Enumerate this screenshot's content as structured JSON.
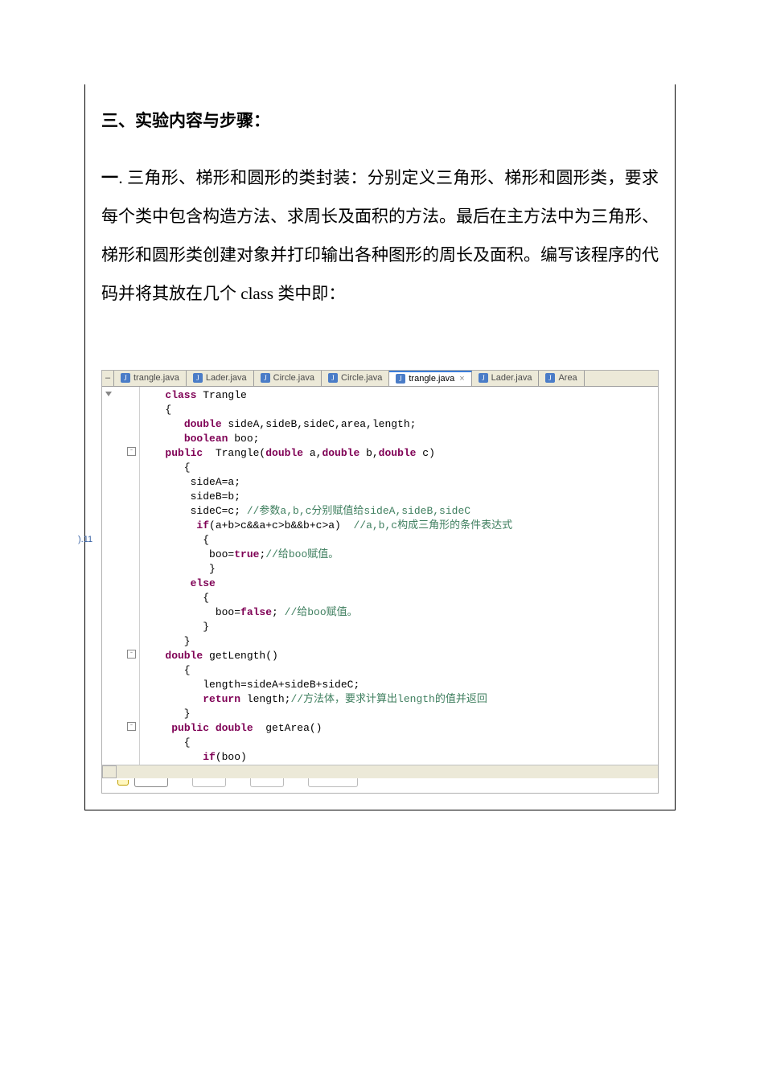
{
  "heading": "三、实验内容与步骤：",
  "body_prefix_bold": "一",
  "body_text": ". 三角形、梯形和圆形的类封装：分别定义三角形、梯形和圆形类，要求每个类中包含构造方法、求周长及面积的方法。最后在主方法中为三角形、梯形和圆形类创建对象并打印输出各种图形的周长及面积。编写该程序的代码并将其放在几个 class 类中即：",
  "tabs": [
    {
      "label": "trangle.java",
      "active": false
    },
    {
      "label": "Lader.java",
      "active": false
    },
    {
      "label": "Circle.java",
      "active": false
    },
    {
      "label": "Circle.java",
      "active": false
    },
    {
      "label": "trangle.java",
      "active": true
    },
    {
      "label": "Lader.java",
      "active": false
    },
    {
      "label": "Area",
      "active": false
    }
  ],
  "breakpoint_label": ").11",
  "code_lines": [
    {
      "indent": 1,
      "tokens": [
        [
          "kw",
          "class"
        ],
        [
          "",
          " Trangle"
        ]
      ]
    },
    {
      "indent": 1,
      "tokens": [
        [
          "",
          "{"
        ]
      ]
    },
    {
      "indent": 2,
      "tokens": [
        [
          "kw",
          "double"
        ],
        [
          "",
          " sideA,sideB,sideC,area,length;"
        ]
      ]
    },
    {
      "indent": 2,
      "tokens": [
        [
          "kw",
          "boolean"
        ],
        [
          "",
          " boo;"
        ]
      ]
    },
    {
      "indent": 1,
      "tokens": [
        [
          "kw",
          "public"
        ],
        [
          "",
          "  Trangle("
        ],
        [
          "kw",
          "double"
        ],
        [
          "",
          " a,"
        ],
        [
          "kw",
          "double"
        ],
        [
          "",
          " b,"
        ],
        [
          "kw",
          "double"
        ],
        [
          "",
          " c)"
        ]
      ],
      "fold": true
    },
    {
      "indent": 2,
      "tokens": [
        [
          "",
          "{"
        ]
      ]
    },
    {
      "indent": 2,
      "tokens": [
        [
          "",
          " sideA=a;"
        ]
      ]
    },
    {
      "indent": 2,
      "tokens": [
        [
          "",
          " sideB=b;"
        ]
      ]
    },
    {
      "indent": 2,
      "tokens": [
        [
          "",
          " sideC=c; "
        ],
        [
          "comment",
          "//参数a,b,c分别赋值给sideA,sideB,sideC"
        ]
      ]
    },
    {
      "indent": 2,
      "tokens": [
        [
          "",
          "  "
        ],
        [
          "kw",
          "if"
        ],
        [
          "",
          "(a+b>c&&a+c>b&&b+c>a)  "
        ],
        [
          "comment",
          "//a,b,c构成三角形的条件表达式"
        ]
      ]
    },
    {
      "indent": 3,
      "tokens": [
        [
          "",
          "{"
        ]
      ],
      "bp": true
    },
    {
      "indent": 3,
      "tokens": [
        [
          "",
          " boo="
        ],
        [
          "kw",
          "true"
        ],
        [
          "",
          ";"
        ],
        [
          "comment",
          "//给boo赋值。"
        ]
      ]
    },
    {
      "indent": 3,
      "tokens": [
        [
          "",
          " }"
        ]
      ]
    },
    {
      "indent": 2,
      "tokens": [
        [
          "",
          " "
        ],
        [
          "kw",
          "else"
        ]
      ]
    },
    {
      "indent": 3,
      "tokens": [
        [
          "",
          "{"
        ]
      ]
    },
    {
      "indent": 3,
      "tokens": [
        [
          "",
          "  boo="
        ],
        [
          "kw",
          "false"
        ],
        [
          "",
          "; "
        ],
        [
          "comment",
          "//给boo赋值。"
        ]
      ]
    },
    {
      "indent": 3,
      "tokens": [
        [
          "",
          "}"
        ]
      ]
    },
    {
      "indent": 2,
      "tokens": [
        [
          "",
          "}"
        ]
      ]
    },
    {
      "indent": 1,
      "tokens": [
        [
          "kw",
          "double"
        ],
        [
          "",
          " getLength()"
        ]
      ],
      "fold": true
    },
    {
      "indent": 2,
      "tokens": [
        [
          "",
          "{"
        ]
      ]
    },
    {
      "indent": 3,
      "tokens": [
        [
          "",
          "length=sideA+sideB+sideC;"
        ]
      ]
    },
    {
      "indent": 3,
      "tokens": [
        [
          "kw",
          "return"
        ],
        [
          "",
          " length;"
        ],
        [
          "comment",
          "//方法体，要求计算出length的值并返回"
        ]
      ]
    },
    {
      "indent": 2,
      "tokens": [
        [
          "",
          "}"
        ]
      ]
    },
    {
      "indent": 1,
      "tokens": [
        [
          "",
          " "
        ],
        [
          "kw",
          "public"
        ],
        [
          "",
          " "
        ],
        [
          "kw",
          "double"
        ],
        [
          "",
          "  getArea()"
        ]
      ],
      "fold": true
    },
    {
      "indent": 2,
      "tokens": [
        [
          "",
          "{"
        ]
      ]
    },
    {
      "indent": 3,
      "tokens": [
        [
          "kw",
          "if"
        ],
        [
          "",
          "(boo)"
        ]
      ]
    }
  ]
}
